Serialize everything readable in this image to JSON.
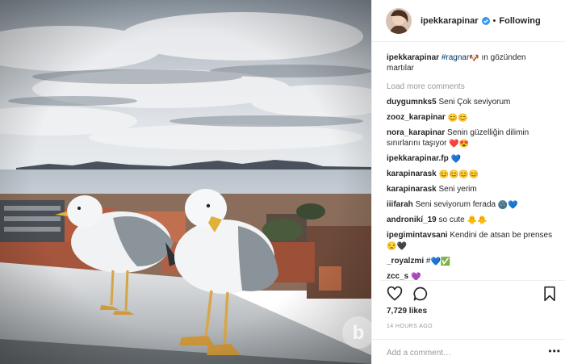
{
  "header": {
    "username": "ipekkarapinar",
    "separator": "•",
    "follow_status": "Following",
    "verified_icon": "verified-badge-icon",
    "verified_color": "#3897f0"
  },
  "caption": {
    "username": "ipekkarapinar",
    "mention": "#ragnar",
    "emoji": "🐶",
    "text": " ın gözünden martılar"
  },
  "load_more": "Load more comments",
  "comments": [
    {
      "user": "duygumnks5",
      "text": "Seni Çok seviyorum",
      "emoji": ""
    },
    {
      "user": "zooz_karapinar",
      "text": "",
      "emoji": "😊😊"
    },
    {
      "user": "nora_karapinar",
      "text": "Senin güzelliğin dilimin sınırlarını taşıyor",
      "emoji": "❤️😍"
    },
    {
      "user": "ipekkarapinar.fp",
      "text": "",
      "emoji": "💙"
    },
    {
      "user": "karapinarask",
      "text": "",
      "emoji": "😊😊😊😊"
    },
    {
      "user": "karapinarask",
      "text": "Seni yerim",
      "emoji": ""
    },
    {
      "user": "iiifarah",
      "text": "Seni seviyorum ferada",
      "emoji": "🌚💙"
    },
    {
      "user": "andronikí_19",
      "text": "so cute",
      "emoji": "🐥🐥"
    },
    {
      "user": "ipegimintavsani",
      "text": "Kendini de atsan be prenses",
      "emoji": "😒🖤"
    },
    {
      "user": "_royalzmi",
      "text": "#",
      "emoji": "💙✅"
    },
    {
      "user": "zcc_s",
      "text": "",
      "emoji": "💜"
    }
  ],
  "actions": {
    "like_icon": "heart-icon",
    "comment_icon": "comment-bubble-icon",
    "save_icon": "bookmark-icon"
  },
  "likes": "7,729 likes",
  "time_ago": "14 HOURS AGO",
  "add_comment": {
    "placeholder": "Add a comment…",
    "more_icon": "more-options-icon",
    "more_label": "•••"
  },
  "photo": {
    "description_icon": "seagulls-photo",
    "watermark_letter": "b"
  }
}
